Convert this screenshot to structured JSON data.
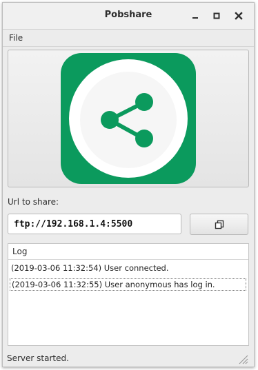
{
  "window": {
    "title": "Pobshare"
  },
  "menu": {
    "file_label": "File"
  },
  "logo": {
    "icon": "share-icon",
    "tile_color": "#0b9a5d",
    "circle_color": "#ffffff"
  },
  "url_section": {
    "label": "Url to share:",
    "value": "ftp://192.168.1.4:5500",
    "copy_button_icon": "copy-icon"
  },
  "log": {
    "header": "Log",
    "entries": [
      {
        "text": "(2019-03-06 11:32:54) User connected.",
        "selected": false
      },
      {
        "text": "(2019-03-06 11:32:55) User anonymous has log in.",
        "selected": true
      }
    ]
  },
  "status": {
    "text": "Server started."
  }
}
